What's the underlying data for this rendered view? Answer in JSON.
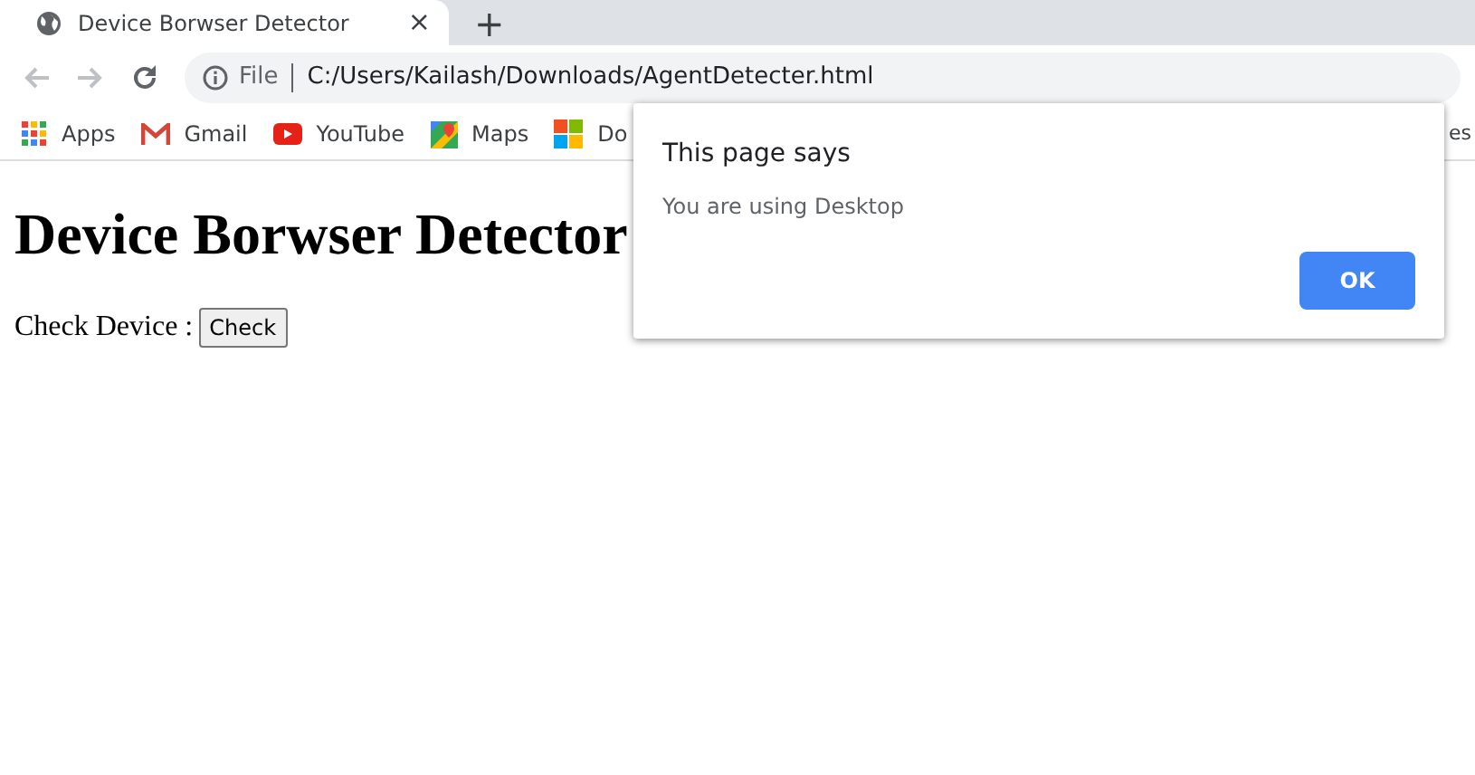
{
  "tab": {
    "title": "Device Borwser Detector",
    "close": "×",
    "new_tab": "+"
  },
  "address_bar": {
    "scheme": "File",
    "url": "C:/Users/Kailash/Downloads/AgentDetecter.html"
  },
  "bookmarks": [
    {
      "label": "Apps",
      "kind": "apps"
    },
    {
      "label": "Gmail",
      "kind": "gmail"
    },
    {
      "label": "YouTube",
      "kind": "youtube"
    },
    {
      "label": "Maps",
      "kind": "maps"
    },
    {
      "label": "Do",
      "kind": "windows"
    }
  ],
  "bookmarks_right": "es",
  "page": {
    "heading": "Device Borwser Detector",
    "label": "Check Device :",
    "button": "Check"
  },
  "dialog": {
    "title": "This page says",
    "message": "You are using Desktop",
    "button": "OK"
  }
}
